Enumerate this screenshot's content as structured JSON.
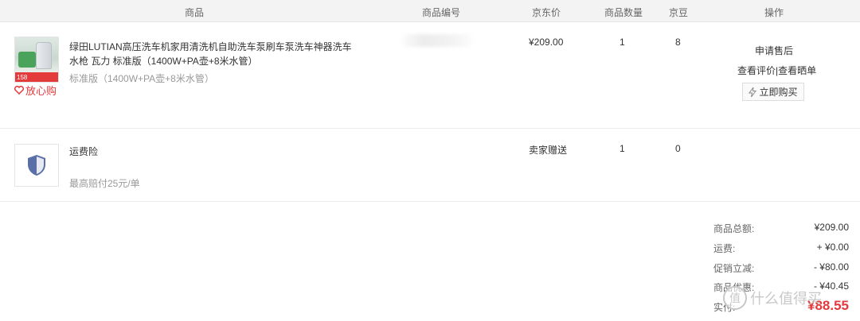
{
  "header": {
    "product": "商品",
    "code": "商品编号",
    "price": "京东价",
    "quantity": "商品数量",
    "jingdou": "京豆",
    "ops": "操作"
  },
  "items": [
    {
      "title_line1": "绿田LUTIAN高压洗车机家用清洗机自助洗车泵刷车泵洗车神器洗车",
      "title_line2": "水枪 瓦力 标准版（1400W+PA壶+8米水管）",
      "spec": "标准版（1400W+PA壶+8米水管）",
      "badge": "放心购",
      "thumb_price": "158",
      "price": "¥209.00",
      "quantity": "1",
      "jingdou": "8",
      "ops": {
        "after_sale": "申请售后",
        "review": "查看评价|查看晒单",
        "buy_again": "立即购买"
      }
    },
    {
      "title_line1": "运费险",
      "spec": "最高赔付25元/单",
      "price": "卖家赠送",
      "quantity": "1",
      "jingdou": "0",
      "icon": "shield-icon"
    }
  ],
  "summary": {
    "total_label": "商品总额:",
    "total_value": "¥209.00",
    "shipping_label": "运费:",
    "shipping_value": "+ ¥0.00",
    "promo_label": "促销立减:",
    "promo_value": "- ¥80.00",
    "coupon_label": "商品优惠:",
    "coupon_value": "- ¥40.45",
    "paid_label": "实付:",
    "paid_value": "¥88.55"
  },
  "watermark": {
    "text": "什么值得买",
    "logo_glyph": "值"
  },
  "colors": {
    "accent_red": "#e4393c",
    "shield_blue": "#5a6fa8",
    "header_bg": "#f3f3f3"
  }
}
